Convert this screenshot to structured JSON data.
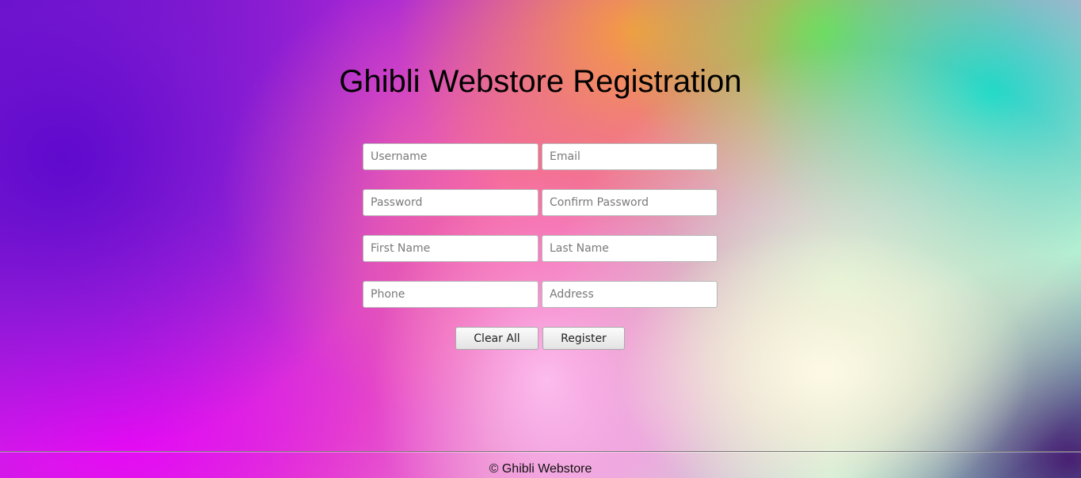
{
  "page": {
    "title": "Ghibli Webstore Registration"
  },
  "form": {
    "rows": [
      {
        "left_placeholder": "Username",
        "right_placeholder": "Email"
      },
      {
        "left_placeholder": "Password",
        "right_placeholder": "Confirm Password"
      },
      {
        "left_placeholder": "First Name",
        "right_placeholder": "Last Name"
      },
      {
        "left_placeholder": "Phone",
        "right_placeholder": "Address"
      }
    ],
    "clear_label": "Clear All",
    "register_label": "Register"
  },
  "footer": {
    "text": "© Ghibli Webstore"
  }
}
